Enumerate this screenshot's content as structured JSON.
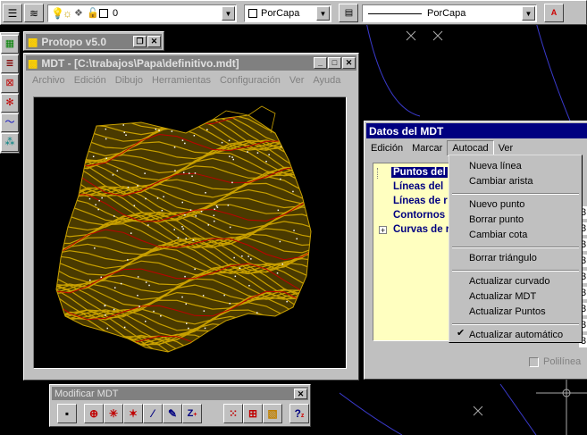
{
  "toolbar": {
    "layer_value": "0",
    "color_value": "PorCapa",
    "linetype_value": "PorCapa"
  },
  "protopo": {
    "title": "Protopo v5.0"
  },
  "mdt_window": {
    "title": "MDT - [C:\\trabajos\\Papa\\definitivo.mdt]",
    "menu": [
      "Archivo",
      "Edición",
      "Dibujo",
      "Herramientas",
      "Configuración",
      "Ver",
      "Ayuda"
    ]
  },
  "datos_window": {
    "title": "Datos del MDT",
    "menu": [
      "Edición",
      "Marcar",
      "Autocad",
      "Ver"
    ],
    "tree": [
      "Puntos del",
      "Líneas del",
      "Líneas de r",
      "Contornos",
      "Curvas de r"
    ],
    "side_values": [
      "3",
      "3",
      "3",
      "3",
      "3",
      "3",
      "3",
      "3",
      "3"
    ],
    "polilinea_label": "Polilínea"
  },
  "autocad_menu": {
    "groups": [
      [
        "Nueva línea",
        "Cambiar arista"
      ],
      [
        "Nuevo punto",
        "Borrar punto",
        "Cambiar cota"
      ],
      [
        "Borrar triángulo"
      ],
      [
        "Actualizar curvado",
        "Actualizar MDT",
        "Actualizar Puntos"
      ],
      [
        "Actualizar automático"
      ]
    ],
    "checked_item": "Actualizar automático"
  },
  "modificar_toolbar": {
    "title": "Modificar MDT"
  },
  "colors": {
    "title_active": "#000080",
    "title_inactive": "#808080",
    "contour_yellow": "#c8a000",
    "contour_red": "#c00000",
    "tree_bg": "#ffffc0"
  }
}
